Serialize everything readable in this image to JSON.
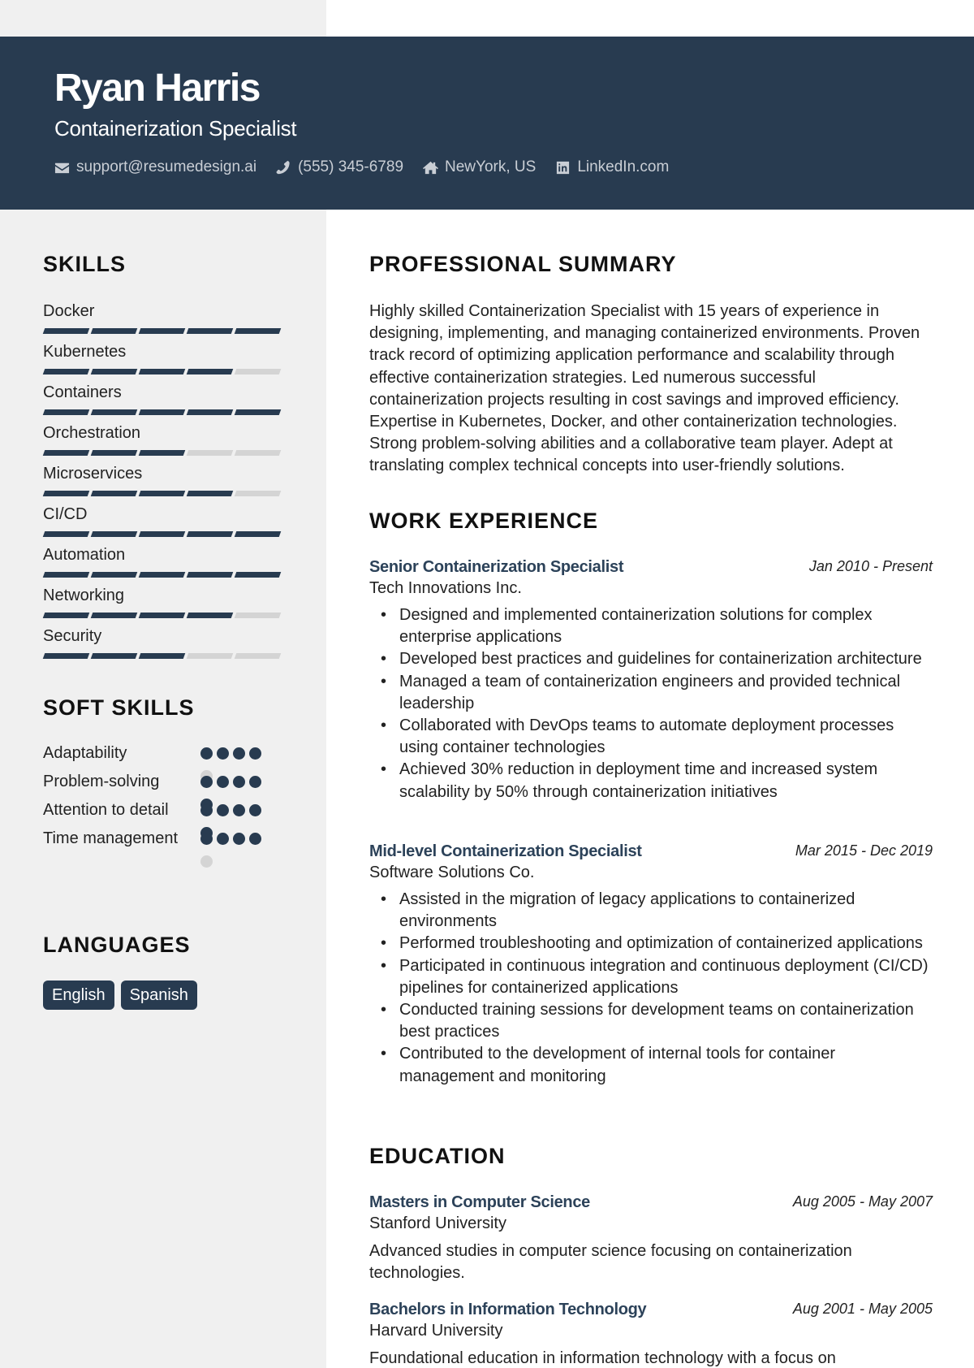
{
  "header": {
    "name": "Ryan Harris",
    "role": "Containerization Specialist",
    "contacts": [
      {
        "icon": "envelope-icon",
        "text": "support@resumedesign.ai"
      },
      {
        "icon": "phone-icon",
        "text": "(555) 345-6789"
      },
      {
        "icon": "home-icon",
        "text": "NewYork, US"
      },
      {
        "icon": "linkedin-icon",
        "text": "LinkedIn.com"
      }
    ]
  },
  "colors": {
    "accent": "#283b50",
    "sidebar": "#f0f0f0",
    "inactive": "#d4d4d4",
    "job_title": "#2c4259"
  },
  "sidebar": {
    "skills_title": "SKILLS",
    "skills": [
      {
        "name": "Docker",
        "level": 5,
        "max": 5
      },
      {
        "name": "Kubernetes",
        "level": 4,
        "max": 5
      },
      {
        "name": "Containers",
        "level": 5,
        "max": 5
      },
      {
        "name": "Orchestration",
        "level": 3,
        "max": 5
      },
      {
        "name": "Microservices",
        "level": 4,
        "max": 5
      },
      {
        "name": "CI/CD",
        "level": 5,
        "max": 5
      },
      {
        "name": "Automation",
        "level": 5,
        "max": 5
      },
      {
        "name": "Networking",
        "level": 4,
        "max": 5
      },
      {
        "name": "Security",
        "level": 3,
        "max": 5
      }
    ],
    "soft_skills_title": "SOFT SKILLS",
    "soft_skills": [
      {
        "name": "Adaptability",
        "level": 4,
        "max": 5
      },
      {
        "name": "Problem-solving",
        "level": 5,
        "max": 5
      },
      {
        "name": "Attention to detail",
        "level": 5,
        "max": 5
      },
      {
        "name": "Time management",
        "level": 4,
        "max": 5
      }
    ],
    "languages_title": "LANGUAGES",
    "languages": [
      "English",
      "Spanish"
    ]
  },
  "main": {
    "summary_title": "PROFESSIONAL SUMMARY",
    "summary": "Highly skilled Containerization Specialist with 15 years of experience in designing, implementing, and managing containerized environments. Proven track record of optimizing application performance and scalability through effective containerization strategies. Led numerous successful containerization projects resulting in cost savings and improved efficiency. Expertise in Kubernetes, Docker, and other containerization technologies. Strong problem-solving abilities and a collaborative team player. Adept at translating complex technical concepts into user-friendly solutions.",
    "work_title": "WORK EXPERIENCE",
    "jobs": [
      {
        "title": "Senior Containerization Specialist",
        "date": "Jan 2010 - Present",
        "company": "Tech Innovations Inc.",
        "bullets": [
          "Designed and implemented containerization solutions for complex enterprise applications",
          "Developed best practices and guidelines for containerization architecture",
          "Managed a team of containerization engineers and provided technical leadership",
          "Collaborated with DevOps teams to automate deployment processes using container technologies",
          "Achieved 30% reduction in deployment time and increased system scalability by 50% through containerization initiatives"
        ]
      },
      {
        "title": "Mid-level Containerization Specialist",
        "date": "Mar 2015 - Dec 2019",
        "company": "Software Solutions Co.",
        "bullets": [
          "Assisted in the migration of legacy applications to containerized environments",
          "Performed troubleshooting and optimization of containerized applications",
          "Participated in continuous integration and continuous deployment (CI/CD) pipelines for containerized applications",
          "Conducted training sessions for development teams on containerization best practices",
          "Contributed to the development of internal tools for container management and monitoring"
        ]
      }
    ],
    "education_title": "EDUCATION",
    "education": [
      {
        "degree": "Masters in Computer Science",
        "date": "Aug 2005 - May 2007",
        "school": "Stanford University",
        "description": "Advanced studies in computer science focusing on containerization technologies."
      },
      {
        "degree": "Bachelors in Information Technology",
        "date": "Aug 2001 - May 2005",
        "school": "Harvard University",
        "description": "Foundational education in information technology with a focus on"
      }
    ]
  }
}
